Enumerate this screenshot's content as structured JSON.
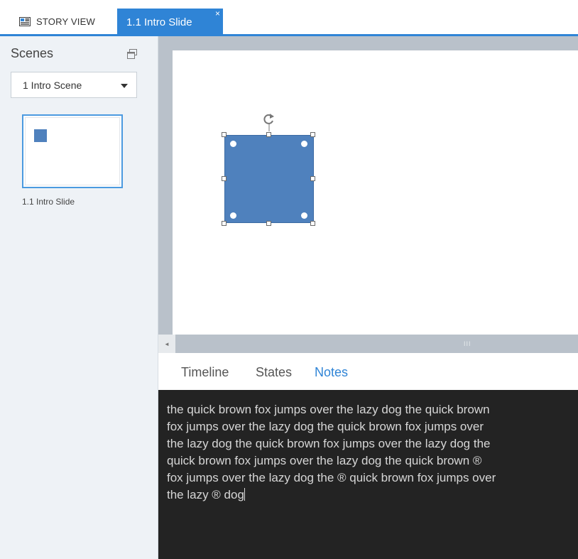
{
  "tabs": {
    "story_view": "STORY VIEW",
    "slide": "1.1 Intro Slide",
    "close_glyph": "×"
  },
  "sidebar": {
    "title": "Scenes",
    "scene_select": "1 Intro Scene",
    "thumbnail_label": "1.1 Intro Slide"
  },
  "bottom_tabs": {
    "timeline": "Timeline",
    "states": "States",
    "notes": "Notes",
    "active": "Notes"
  },
  "notes": {
    "text": "the quick brown fox jumps over the lazy dog the quick brown fox jumps over the lazy dog the quick brown fox jumps over the lazy dog the quick brown fox jumps over the lazy dog the quick brown fox jumps over the lazy dog the quick brown ® fox jumps over the lazy dog the ® quick brown fox jumps over the lazy ® dog"
  },
  "scrollbar": {
    "grip": "III"
  },
  "colors": {
    "accent": "#2f84d6",
    "shape_fill": "#4f81bd",
    "notes_bg": "#232323"
  },
  "icons": {
    "story_view": "storyboard-icon",
    "restore": "restore-window-icon",
    "dropdown": "chevron-down-icon",
    "rotate": "rotate-handle-icon",
    "scroll_left": "arrow-left-icon"
  }
}
